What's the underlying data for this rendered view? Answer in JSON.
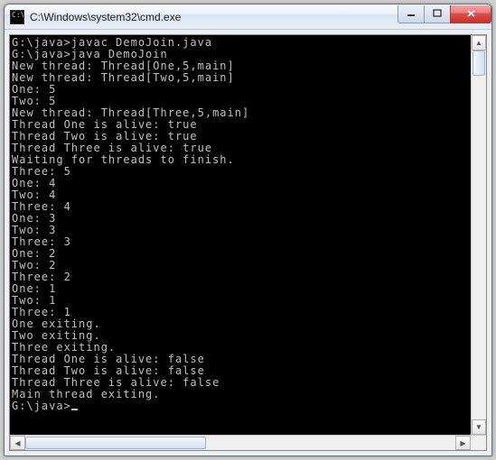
{
  "window": {
    "title": "C:\\Windows\\system32\\cmd.exe",
    "icon_label": "cmd-icon"
  },
  "buttons": {
    "minimize": "Minimize",
    "maximize": "Maximize",
    "close": "Close"
  },
  "console": {
    "lines": [
      "",
      "G:\\java>javac DemoJoin.java",
      "",
      "G:\\java>java DemoJoin",
      "New thread: Thread[One,5,main]",
      "New thread: Thread[Two,5,main]",
      "One: 5",
      "Two: 5",
      "New thread: Thread[Three,5,main]",
      "Thread One is alive: true",
      "Thread Two is alive: true",
      "Thread Three is alive: true",
      "Waiting for threads to finish.",
      "Three: 5",
      "One: 4",
      "Two: 4",
      "Three: 4",
      "One: 3",
      "Two: 3",
      "Three: 3",
      "One: 2",
      "Two: 2",
      "Three: 2",
      "One: 1",
      "Two: 1",
      "Three: 1",
      "One exiting.",
      "Two exiting.",
      "Three exiting.",
      "Thread One is alive: false",
      "Thread Two is alive: false",
      "Thread Three is alive: false",
      "Main thread exiting.",
      "",
      "G:\\java>"
    ],
    "prompt_has_cursor": true
  },
  "scrollbar": {
    "up": "▲",
    "down": "▼",
    "left": "◀",
    "right": "▶"
  }
}
